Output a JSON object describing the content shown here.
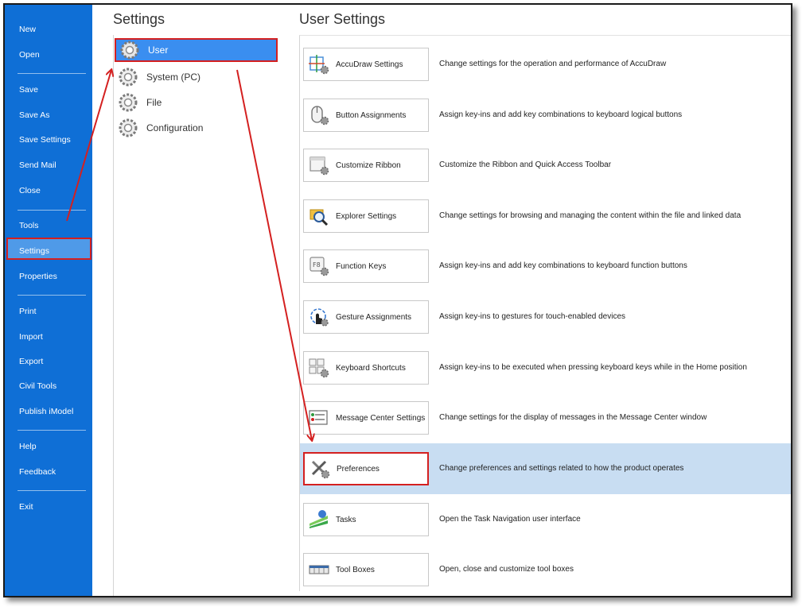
{
  "nav": {
    "items": [
      {
        "label": "New"
      },
      {
        "label": "Open"
      },
      {
        "label": "Save"
      },
      {
        "label": "Save As"
      },
      {
        "label": "Save Settings"
      },
      {
        "label": "Send Mail"
      },
      {
        "label": "Close"
      },
      {
        "label": "Tools"
      },
      {
        "label": "Settings",
        "selected": true
      },
      {
        "label": "Properties"
      },
      {
        "label": "Print"
      },
      {
        "label": "Import"
      },
      {
        "label": "Export"
      },
      {
        "label": "Civil Tools"
      },
      {
        "label": "Publish iModel"
      },
      {
        "label": "Help"
      },
      {
        "label": "Feedback"
      },
      {
        "label": "Exit"
      }
    ]
  },
  "settings": {
    "title": "Settings",
    "categories": [
      {
        "label": "User",
        "selected": true
      },
      {
        "label": "System (PC)"
      },
      {
        "label": "File"
      },
      {
        "label": "Configuration"
      }
    ]
  },
  "user_settings": {
    "title": "User Settings",
    "items": [
      {
        "label": "AccuDraw Settings",
        "desc": "Change settings for the operation and performance of AccuDraw",
        "icon": "accudraw-icon"
      },
      {
        "label": "Button Assignments",
        "desc": "Assign key-ins and add key combinations to keyboard logical buttons",
        "icon": "mouse-icon"
      },
      {
        "label": "Customize Ribbon",
        "desc": "Customize the Ribbon and Quick Access Toolbar",
        "icon": "ribbon-icon"
      },
      {
        "label": "Explorer Settings",
        "desc": "Change settings for browsing and managing the content within the file and linked data",
        "icon": "explorer-icon"
      },
      {
        "label": "Function Keys",
        "desc": "Assign key-ins and add key combinations to keyboard function buttons",
        "icon": "function-key-icon"
      },
      {
        "label": "Gesture Assignments",
        "desc": "Assign key-ins to gestures for touch-enabled devices",
        "icon": "gesture-icon"
      },
      {
        "label": "Keyboard Shortcuts",
        "desc": "Assign key-ins to be executed when pressing keyboard keys while in the Home position",
        "icon": "keyboard-icon"
      },
      {
        "label": "Message Center Settings",
        "desc": "Change settings for the display of messages in the Message Center window",
        "icon": "message-center-icon"
      },
      {
        "label": "Preferences",
        "desc": "Change preferences and settings related to how the product operates",
        "icon": "tools-icon",
        "highlighted": true
      },
      {
        "label": "Tasks",
        "desc": "Open the Task Navigation user interface",
        "icon": "tasks-icon"
      },
      {
        "label": "Tool Boxes",
        "desc": "Open, close and customize tool boxes",
        "icon": "toolbox-icon"
      }
    ]
  },
  "colors": {
    "nav_bg": "#0f6fd6",
    "nav_selected": "#4f9ae8",
    "category_selected": "#3a8ef0",
    "row_highlight": "#c8ddf2",
    "annotation_red": "#d42020"
  }
}
